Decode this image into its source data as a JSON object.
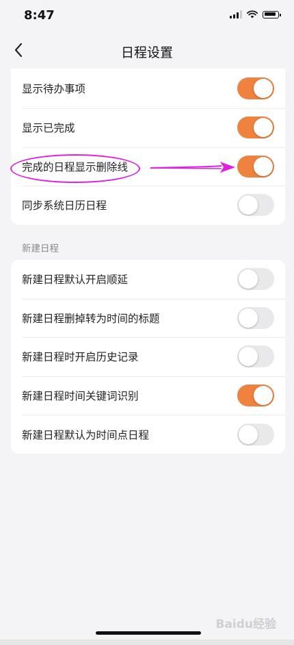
{
  "status_bar": {
    "time": "8:47",
    "battery_level": 0.9
  },
  "nav": {
    "title": "日程设置"
  },
  "settings_card": {
    "items": [
      {
        "label": "显示待办事项",
        "on": true
      },
      {
        "label": "显示已完成",
        "on": true
      },
      {
        "label": "完成的日程显示删除线",
        "on": true
      },
      {
        "label": "同步系统日历日程",
        "on": false
      }
    ]
  },
  "new_schedule": {
    "section_label": "新建日程",
    "items": [
      {
        "label": "新建日程默认开启顺延",
        "on": false
      },
      {
        "label": "新建日程删掉转为时间的标题",
        "on": false
      },
      {
        "label": "新建日程时开启历史记录",
        "on": false
      },
      {
        "label": "新建日程时间关键词识别",
        "on": true
      },
      {
        "label": "新建日程默认为时间点日程",
        "on": false
      }
    ]
  },
  "colors": {
    "accent": "#f08240",
    "annotation": "#e020e0",
    "toggle_off": "#e9e9ec"
  },
  "watermark": "Baidu经验"
}
